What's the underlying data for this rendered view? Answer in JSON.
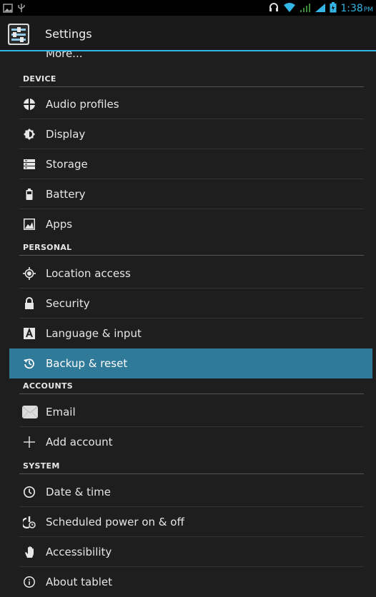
{
  "status_bar": {
    "time": "1:38",
    "ampm": "PM",
    "left_icons": [
      "image-icon",
      "usb-icon"
    ],
    "right_icons": [
      "headset-icon",
      "wifi-icon",
      "signal-icon",
      "signal-icon",
      "battery-icon"
    ]
  },
  "action_bar": {
    "title": "Settings",
    "icon": "settings-sliders-icon"
  },
  "list": {
    "partial_item": "More...",
    "sections": [
      {
        "header": "DEVICE",
        "items": [
          {
            "label": "Audio profiles",
            "icon": "audio-profiles-icon"
          },
          {
            "label": "Display",
            "icon": "display-icon"
          },
          {
            "label": "Storage",
            "icon": "storage-icon"
          },
          {
            "label": "Battery",
            "icon": "battery-icon"
          },
          {
            "label": "Apps",
            "icon": "apps-icon"
          }
        ]
      },
      {
        "header": "PERSONAL",
        "items": [
          {
            "label": "Location access",
            "icon": "location-icon"
          },
          {
            "label": "Security",
            "icon": "lock-icon"
          },
          {
            "label": "Language & input",
            "icon": "language-icon"
          },
          {
            "label": "Backup & reset",
            "icon": "backup-icon",
            "selected": true
          }
        ]
      },
      {
        "header": "ACCOUNTS",
        "items": [
          {
            "label": "Email",
            "icon": "email-icon"
          },
          {
            "label": "Add account",
            "icon": "plus-icon"
          }
        ]
      },
      {
        "header": "SYSTEM",
        "items": [
          {
            "label": "Date & time",
            "icon": "clock-icon"
          },
          {
            "label": "Scheduled power on & off",
            "icon": "power-schedule-icon"
          },
          {
            "label": "Accessibility",
            "icon": "hand-icon"
          },
          {
            "label": "About tablet",
            "icon": "info-icon"
          }
        ]
      }
    ]
  },
  "colors": {
    "accent": "#33b5e5",
    "selected_row": "#2f7a98",
    "background": "#1e1e1e"
  }
}
